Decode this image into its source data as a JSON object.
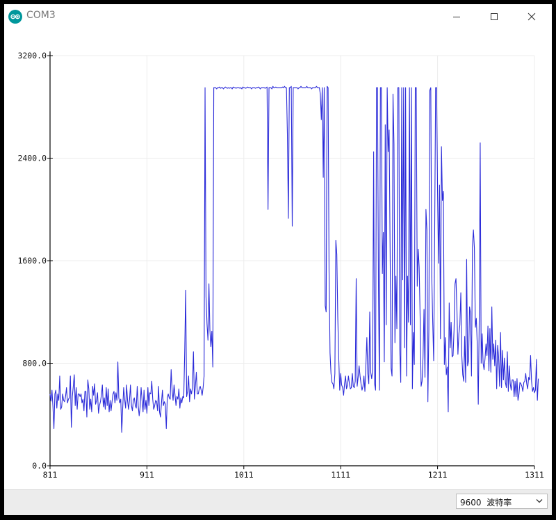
{
  "window": {
    "title": "COM3",
    "icons": {
      "app": "arduino-logo-icon",
      "minimize": "minimize-icon",
      "maximize": "maximize-icon",
      "close": "close-icon"
    }
  },
  "footer": {
    "baud_value": "9600",
    "baud_unit": "波特率",
    "chevron_icon": "chevron-down-icon"
  },
  "colors": {
    "series": "#2b2bd9",
    "grid": "#ececec",
    "axis": "#000000",
    "app_icon": "#00979c"
  },
  "chart_data": {
    "type": "line",
    "xlim": [
      811,
      1311
    ],
    "ylim": [
      0,
      3200
    ],
    "x_ticks": [
      811,
      911,
      1011,
      1111,
      1211,
      1311
    ],
    "y_ticks": [
      0,
      800,
      1600,
      2400,
      3200
    ],
    "x_tick_labels": [
      "811",
      "911",
      "1011",
      "1111",
      "1211",
      "1311"
    ],
    "y_tick_labels": [
      "0.0",
      "800.0",
      "1600.0",
      "2400.0",
      "3200.0"
    ],
    "grid": true,
    "series": [
      {
        "x_start": 811,
        "x_step": 1,
        "values": [
          560,
          505,
          590,
          460,
          290,
          560,
          590,
          450,
          560,
          510,
          700,
          440,
          460,
          560,
          510,
          500,
          540,
          610,
          490,
          520,
          530,
          700,
          300,
          540,
          620,
          710,
          470,
          610,
          440,
          560,
          560,
          540,
          560,
          490,
          520,
          430,
          580,
          580,
          380,
          670,
          600,
          440,
          520,
          420,
          620,
          550,
          640,
          480,
          510,
          570,
          410,
          470,
          500,
          550,
          630,
          460,
          530,
          440,
          610,
          470,
          600,
          420,
          510,
          430,
          500,
          560,
          580,
          490,
          570,
          510,
          810,
          530,
          490,
          520,
          260,
          450,
          610,
          520,
          450,
          630,
          510,
          440,
          510,
          630,
          470,
          430,
          510,
          530,
          470,
          450,
          620,
          470,
          390,
          460,
          610,
          510,
          420,
          590,
          440,
          510,
          410,
          610,
          470,
          570,
          560,
          660,
          520,
          440,
          470,
          510,
          500,
          430,
          620,
          420,
          380,
          490,
          590,
          470,
          500,
          480,
          290,
          530,
          560,
          530,
          520,
          750,
          590,
          510,
          630,
          550,
          470,
          540,
          520,
          600,
          450,
          530,
          490,
          540,
          530,
          890,
          1370,
          540,
          580,
          700,
          500,
          600,
          560,
          610,
          890,
          520,
          620,
          730,
          560,
          560,
          600,
          620,
          590,
          550,
          610,
          700,
          2950,
          1320,
          1110,
          980,
          1420,
          1060,
          930,
          1050,
          770,
          2950,
          2950,
          2950,
          2940,
          2950,
          2950,
          2955,
          2945,
          2950,
          2950,
          2940,
          2950,
          2955,
          2950,
          2945,
          2950,
          2945,
          2950,
          2950,
          2940,
          2955,
          2950,
          2950,
          2945,
          2950,
          2950,
          2950,
          2945,
          2950,
          2940,
          2955,
          2950,
          2950,
          2945,
          2950,
          2955,
          2950,
          2950,
          2950,
          2940,
          2950,
          2950,
          2950,
          2945,
          2950,
          2950,
          2955,
          2950,
          2940,
          2950,
          2950,
          2950,
          2950,
          2945,
          2950,
          2955,
          2000,
          2950,
          2950,
          2950,
          2940,
          2960,
          2950,
          2950,
          2955,
          2950,
          2950,
          2950,
          2950,
          2950,
          2950,
          2955,
          2950,
          2960,
          2950,
          2950,
          2590,
          1930,
          2950,
          2950,
          2960,
          1870,
          2950,
          2950,
          2950,
          2950,
          2950,
          2940,
          2950,
          2950,
          2960,
          2950,
          2950,
          2950,
          2950,
          2950,
          2960,
          2950,
          2950,
          2950,
          2950,
          2940,
          2950,
          2950,
          2950,
          2950,
          2960,
          2950,
          2950,
          2950,
          2900,
          2700,
          2950,
          2250,
          2950,
          1250,
          1200,
          2960,
          2950,
          1520,
          880,
          720,
          650,
          640,
          600,
          720,
          1760,
          1650,
          1160,
          840,
          590,
          720,
          630,
          610,
          550,
          640,
          700,
          600,
          630,
          700,
          640,
          600,
          610,
          720,
          620,
          610,
          660,
          1460,
          620,
          690,
          780,
          700,
          640,
          590,
          620,
          700,
          580,
          780,
          1000,
          720,
          640,
          1200,
          730,
          680,
          750,
          2450,
          640,
          590,
          2950,
          2950,
          1390,
          590,
          2950,
          2950,
          1500,
          1820,
          810,
          2660,
          1100,
          2950,
          2450,
          2620,
          1700,
          760,
          700,
          2900,
          2510,
          960,
          1480,
          1070,
          2950,
          2950,
          910,
          650,
          2950,
          1450,
          2950,
          920,
          2950,
          700,
          1480,
          1120,
          2950,
          1100,
          2950,
          600,
          1040,
          790,
          2950,
          2950,
          1400,
          1690,
          1550,
          1160,
          620,
          660,
          850,
          1220,
          690,
          2000,
          1840,
          500,
          1060,
          2930,
          2950,
          1480,
          1120,
          820,
          1820,
          2950,
          2950,
          2130,
          1580,
          2190,
          990,
          2490,
          2070,
          2140,
          790,
          1000,
          710,
          770,
          420,
          1270,
          920,
          1120,
          850,
          860,
          1060,
          1420,
          1460,
          1210,
          870,
          1030,
          1100,
          1350,
          860,
          710,
          660,
          1010,
          650,
          1610,
          780,
          820,
          1240,
          1190,
          700,
          1710,
          1840,
          1700,
          1080,
          1150,
          940,
          480,
          1130,
          2520,
          800,
          1030,
          800,
          750,
          840,
          950,
          860,
          1090,
          740,
          1070,
          730,
          1240,
          830,
          950,
          780,
          980,
          600,
          940,
          850,
          620,
          1040,
          610,
          900,
          670,
          840,
          650,
          610,
          890,
          580,
          780,
          640,
          590,
          670,
          670,
          540,
          660,
          540,
          680,
          510,
          560,
          650,
          640,
          620,
          580,
          650,
          660,
          720,
          640,
          600,
          690,
          670,
          860,
          660,
          580,
          610,
          570,
          590,
          830,
          510,
          680
        ]
      }
    ]
  }
}
